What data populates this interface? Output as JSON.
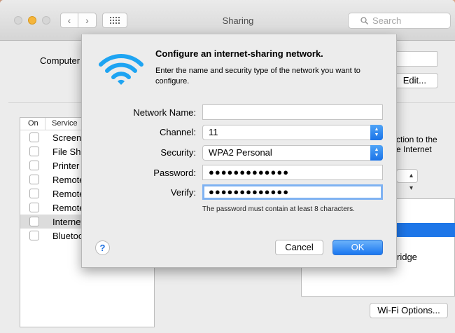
{
  "window": {
    "title": "Sharing",
    "search_placeholder": "Search"
  },
  "main": {
    "computer_label": "Computer",
    "edit_button": "Edit...",
    "service_list": {
      "col_on": "On",
      "col_service": "Service",
      "items": [
        {
          "label": "Screen",
          "checked": false,
          "selected": false
        },
        {
          "label": "File Sha",
          "checked": false,
          "selected": false
        },
        {
          "label": "Printer",
          "checked": false,
          "selected": false
        },
        {
          "label": "Remote",
          "checked": false,
          "selected": false
        },
        {
          "label": "Remote",
          "checked": false,
          "selected": false
        },
        {
          "label": "Remote",
          "checked": false,
          "selected": false
        },
        {
          "label": "Internet",
          "checked": false,
          "selected": true
        },
        {
          "label": "Bluetoo",
          "checked": false,
          "selected": false
        }
      ]
    },
    "right_text_1": "ction to the",
    "right_text_2": "e Internet",
    "right_box_item": "ridge",
    "wifi_options_button": "Wi-Fi Options..."
  },
  "sheet": {
    "icon": "wifi-icon",
    "title": "Configure an internet-sharing network.",
    "description": "Enter the name and security type of the network you want to configure.",
    "fields": {
      "network_name_label": "Network Name:",
      "network_name_value": "",
      "channel_label": "Channel:",
      "channel_value": "11",
      "security_label": "Security:",
      "security_value": "WPA2 Personal",
      "password_label": "Password:",
      "password_value": "●●●●●●●●●●●●●",
      "verify_label": "Verify:",
      "verify_value": "●●●●●●●●●●●●●"
    },
    "hint": "The password must contain at least 8 characters.",
    "cancel_button": "Cancel",
    "ok_button": "OK",
    "help_button": "?"
  },
  "colors": {
    "accent": "#1a76f0",
    "focus_ring": "#7fb2f2",
    "wifi_icon": "#1ea4f2"
  }
}
